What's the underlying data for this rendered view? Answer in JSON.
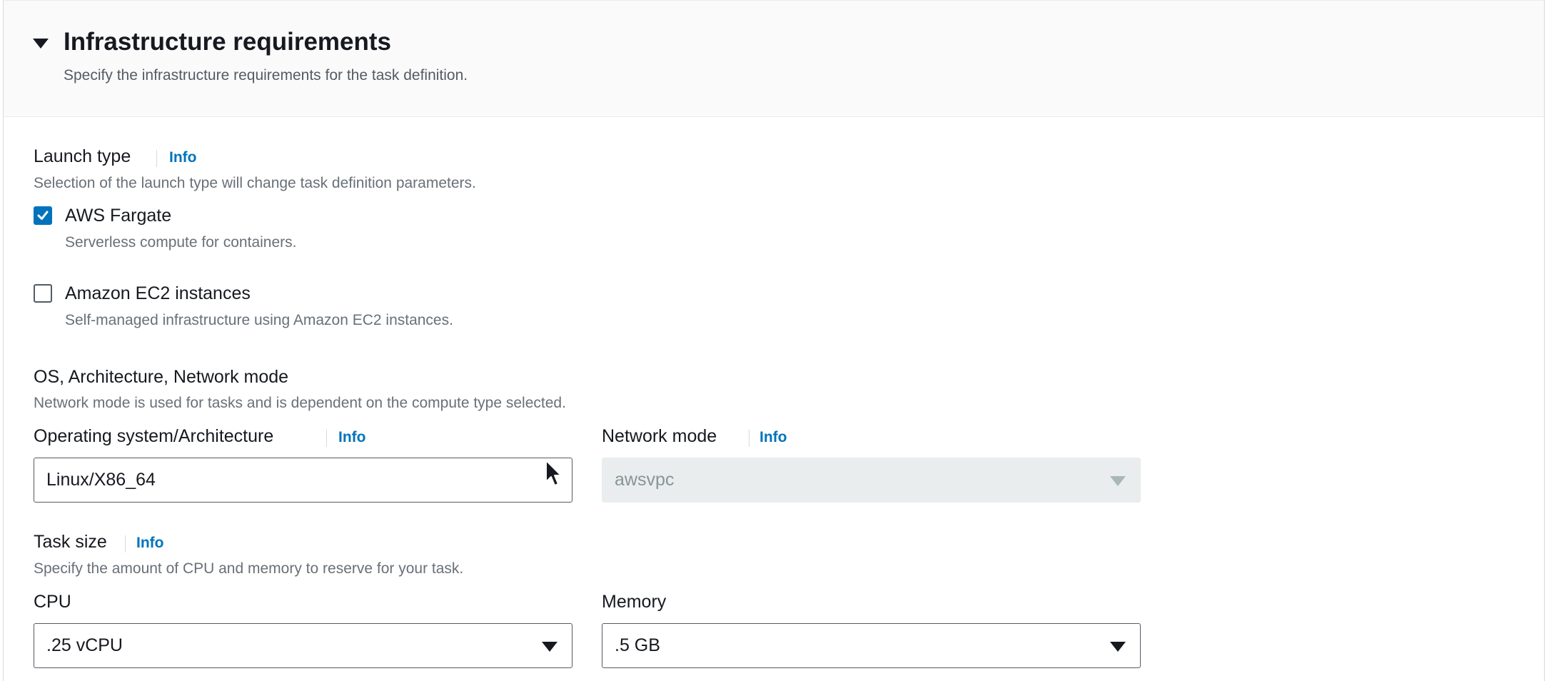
{
  "section": {
    "title": "Infrastructure requirements",
    "description": "Specify the infrastructure requirements for the task definition."
  },
  "launch_type": {
    "label": "Launch type",
    "info": "Info",
    "description": "Selection of the launch type will change task definition parameters.",
    "options": [
      {
        "label": "AWS Fargate",
        "description": "Serverless compute for containers.",
        "checked": true
      },
      {
        "label": "Amazon EC2 instances",
        "description": "Self-managed infrastructure using Amazon EC2 instances.",
        "checked": false
      }
    ]
  },
  "os_network": {
    "label": "OS, Architecture, Network mode",
    "description": "Network mode is used for tasks and is dependent on the compute type selected.",
    "os_arch": {
      "label": "Operating system/Architecture",
      "info": "Info",
      "value": "Linux/X86_64"
    },
    "network_mode": {
      "label": "Network mode",
      "info": "Info",
      "value": "awsvpc",
      "disabled": true
    }
  },
  "task_size": {
    "label": "Task size",
    "info": "Info",
    "description": "Specify the amount of CPU and memory to reserve for your task.",
    "cpu": {
      "label": "CPU",
      "value": ".25 vCPU"
    },
    "memory": {
      "label": "Memory",
      "value": ".5 GB"
    }
  },
  "colors": {
    "accent": "#0073bb",
    "text": "#16191f",
    "secondary_text": "#687078",
    "header_bg": "#fafafa",
    "disabled_bg": "#eaeded"
  },
  "icons": {
    "caret": "caret-down-icon",
    "check": "check-icon",
    "dropdown": "dropdown-arrow-icon",
    "cursor": "mouse-cursor-icon"
  }
}
